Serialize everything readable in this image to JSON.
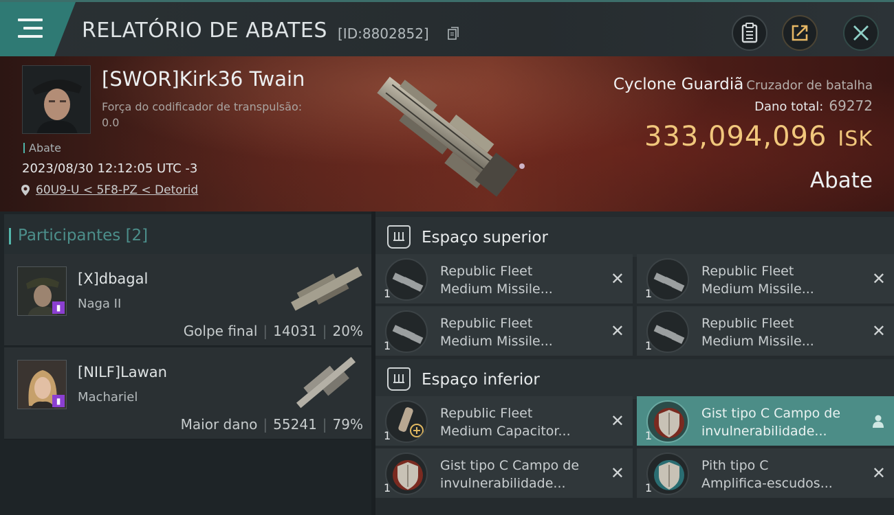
{
  "header": {
    "title": "RELATÓRIO DE ABATES",
    "report_id": "[ID:8802852]"
  },
  "victim": {
    "name": "[SWOR]Kirk36 Twain",
    "stat_label": "Força do codificador de transpulsão:",
    "stat_value": "0.0",
    "tag": "Abate",
    "datetime": "2023/08/30 12:12:05 UTC -3",
    "location": "60U9-U < 5F8-PZ < Detorid"
  },
  "ship": {
    "name": "Cyclone Guardiã",
    "class": "Cruzador de batalha",
    "total_damage_label": "Dano total:",
    "total_damage": "69272",
    "isk_value": "333,094,096",
    "isk_unit": "ISK",
    "loss_type": "Abate"
  },
  "participants": {
    "label": "Participantes [2]",
    "items": [
      {
        "name": "[X]dbagal",
        "ship": "Naga II",
        "role": "Golpe final",
        "damage": "14031",
        "percent": "20%"
      },
      {
        "name": "[NILF]Lawan",
        "ship": "Machariel",
        "role": "Maior dano",
        "damage": "55241",
        "percent": "79%"
      }
    ]
  },
  "upper_slots": {
    "label": "Espaço superior",
    "items": [
      {
        "qty": "1",
        "name_line1": "Republic Fleet",
        "name_line2": "Medium Missile..."
      },
      {
        "qty": "1",
        "name_line1": "Republic Fleet",
        "name_line2": "Medium Missile..."
      },
      {
        "qty": "1",
        "name_line1": "Republic Fleet",
        "name_line2": "Medium Missile..."
      },
      {
        "qty": "1",
        "name_line1": "Republic Fleet",
        "name_line2": "Medium Missile..."
      }
    ]
  },
  "lower_slots": {
    "label": "Espaço inferior",
    "items": [
      {
        "qty": "1",
        "name_line1": "Republic Fleet",
        "name_line2": "Medium Capacitor..."
      },
      {
        "qty": "1",
        "name_line1": "Gist tipo C Campo de",
        "name_line2": "invulnerabilidade..."
      },
      {
        "qty": "1",
        "name_line1": "Gist tipo C Campo de",
        "name_line2": "invulnerabilidade..."
      },
      {
        "qty": "1",
        "name_line1": "Pith tipo C",
        "name_line2": "Amplifica-escudos..."
      }
    ]
  },
  "colors": {
    "accent_teal": "#2f7a74",
    "isk_gold": "#f1c77c",
    "selected_row": "#4c8d87"
  }
}
